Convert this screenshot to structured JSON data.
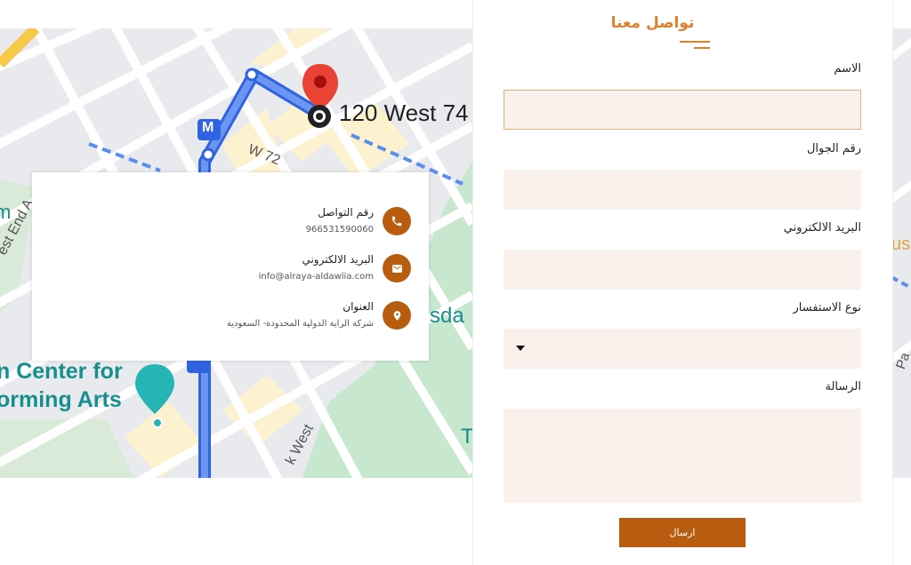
{
  "map": {
    "place_label": "120 West 74",
    "street_label": "W 72",
    "center_label_line1": "n Center for",
    "center_label_line2": "orming Arts",
    "side_label_1": "est End A",
    "side_label_2": "k West",
    "side_label_3": "sda",
    "side_label_4": "m",
    "side_label_5": "T",
    "side_label_6": "us",
    "side_label_7": "Pa",
    "transit_badge": "M"
  },
  "contact": {
    "phone_title": "رقم التواصل",
    "phone_value": "966531590060",
    "email_title": "البريد الالكتروني",
    "email_value": "info@alraya-aldawlia.com",
    "address_title": "العنوان",
    "address_value": "شركة الراية الدولية المحدودة- السعودية"
  },
  "form": {
    "title": "تواصل معنا",
    "name_label": "الاسم",
    "phone_label": "رقم الجوال",
    "email_label": "البريد الالكتروني",
    "type_label": "نوع الاستفسار",
    "message_label": "الرسالة",
    "send_label": "ارسال"
  },
  "colors": {
    "accent": "#e0802c",
    "button": "#b85c10",
    "field_bg": "#fbf1ec"
  }
}
